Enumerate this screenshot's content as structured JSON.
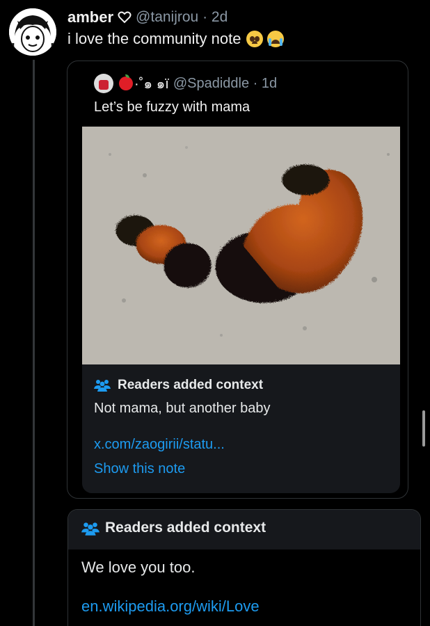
{
  "tweet": {
    "author_name": "amber",
    "author_handle": "@tanijrou · 2d",
    "text": "i love the community note",
    "emojis": [
      "pleading-face",
      "loudly-crying-face"
    ]
  },
  "quoted_tweet": {
    "author_name": "·˚๑ ๑ï",
    "author_handle": "@Spadiddle · 1d",
    "text": "Let’s be fuzzy with mama",
    "image_subject": "two woolly bear caterpillars on concrete",
    "community_note": {
      "title": "Readers added context",
      "body": "Not mama, but another baby",
      "link": "x.com/zaogirii/statu...",
      "show_note": "Show this note"
    }
  },
  "community_note": {
    "title": "Readers added context",
    "body": "We love you too.",
    "link": "en.wikipedia.org/wiki/Love"
  },
  "colors": {
    "background": "#000000",
    "text": "#e7e9ea",
    "muted": "#8b98a5",
    "link": "#1d9bf0",
    "note_bg": "#16181c",
    "border": "#2f3336"
  }
}
